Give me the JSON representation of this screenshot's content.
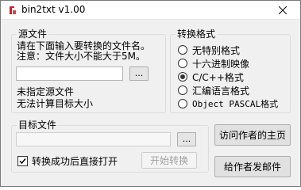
{
  "window": {
    "title": "bin2txt v1.00"
  },
  "source_group": {
    "legend": "源文件",
    "instruction": "请在下面输入要转换的文件名。",
    "note": "注意：文件大小不能大于5M。",
    "path_value": "",
    "browse_label": "...",
    "status_line1": "未指定源文件",
    "status_line2": "无法计算目标大小"
  },
  "format_group": {
    "legend": "转换格式",
    "options": [
      {
        "label": "无特别格式",
        "checked": false
      },
      {
        "label": "十六进制映像",
        "checked": false
      },
      {
        "label": "C/C++格式",
        "checked": true
      },
      {
        "label": "汇编语言格式",
        "checked": false
      },
      {
        "label": "Object PASCAL格式",
        "checked": false
      }
    ]
  },
  "target_group": {
    "legend": "目标文件",
    "path_value": "",
    "browse_label": "...",
    "open_after_label": "转换成功后直接打开",
    "open_after_checked": true,
    "start_label": "开始转换"
  },
  "actions": {
    "visit_homepage_label": "访问作者的主页",
    "email_author_label": "给作者发邮件"
  },
  "icons": {
    "app_icon": "bin2txt-app-icon",
    "close_icon": "close-icon",
    "check_icon": "checkmark-icon"
  },
  "colors": {
    "app_icon_red": "#d42020",
    "window_bg": "#f0f0f0"
  }
}
